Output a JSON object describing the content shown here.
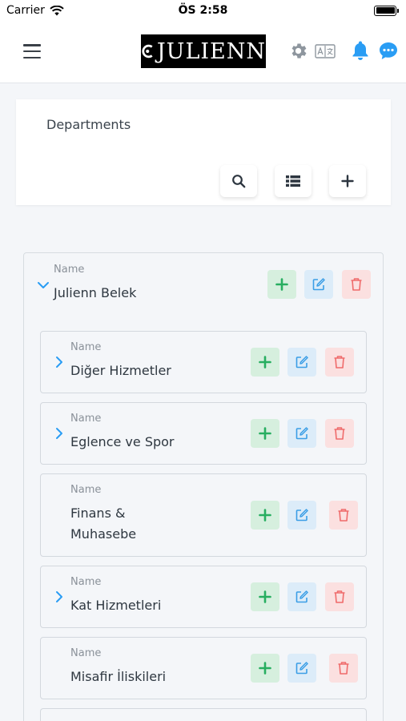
{
  "status_bar": {
    "carrier": "Carrier",
    "time": "ÖS 2:58"
  },
  "header": {
    "logo_text": "JULIENN"
  },
  "panel": {
    "title": "Departments"
  },
  "colors": {
    "add": "#27ae60",
    "edit": "#3b9ee6",
    "delete": "#ef6b6b",
    "bell": "#2a9df4"
  },
  "root": {
    "label": "Name",
    "name": "Julienn Belek"
  },
  "children": [
    {
      "label": "Name",
      "name": "Diğer Hizmetler"
    },
    {
      "label": "Name",
      "name": "Eglence ve Spor"
    },
    {
      "label": "Name",
      "name_line1": "Finans &",
      "name_line2": "Muhasebe"
    },
    {
      "label": "Name",
      "name": "Kat Hizmetleri"
    },
    {
      "label": "Name",
      "name": "Misafir İliskileri"
    }
  ]
}
